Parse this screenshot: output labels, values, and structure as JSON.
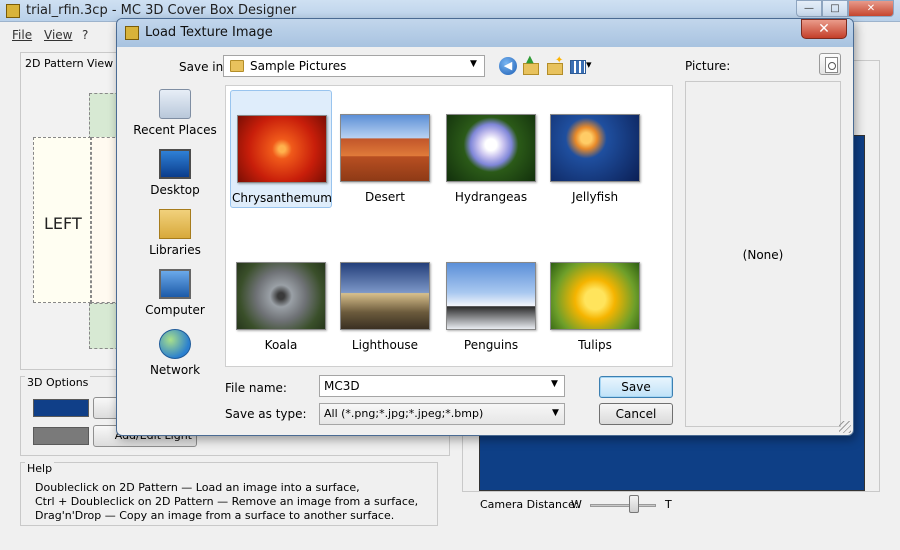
{
  "main_window": {
    "title": "trial_rfin.3cp - MC 3D Cover Box Designer",
    "menu": {
      "file": "File",
      "view": "View",
      "help": "?"
    },
    "pattern_panel": {
      "title": "2D Pattern View",
      "left_label": "LEFT"
    },
    "options_panel": {
      "title": "3D Options",
      "button_partial": "Add/Edit Light"
    },
    "help_panel": {
      "title": "Help",
      "lines": [
        "Doubleclick on 2D Pattern — Load an image into a surface,",
        "Ctrl + Doubleclick on 2D Pattern — Remove an image from a surface,",
        "Drag'n'Drop — Copy an image from a surface to another surface."
      ]
    },
    "camera": {
      "label": "Camera Distance:",
      "min_label": "W",
      "max_label": "T",
      "value": 0.7
    },
    "colors": {
      "swatch_primary": "#103f88",
      "swatch_secondary": "#7a7a7a",
      "preview_background": "#0e3f86"
    }
  },
  "dialog": {
    "title": "Load Texture Image",
    "close_glyph": "✕",
    "save_in_label": "Save in:",
    "save_in_value": "Sample Pictures",
    "places": [
      "Recent Places",
      "Desktop",
      "Libraries",
      "Computer",
      "Network"
    ],
    "files": [
      {
        "name": "Chrysanthemum",
        "selected": true
      },
      {
        "name": "Desert"
      },
      {
        "name": "Hydrangeas"
      },
      {
        "name": "Jellyfish"
      },
      {
        "name": "Koala"
      },
      {
        "name": "Lighthouse"
      },
      {
        "name": "Penguins"
      },
      {
        "name": "Tulips"
      }
    ],
    "picture_label": "Picture:",
    "picture_none": "(None)",
    "file_name_label": "File name:",
    "file_name_value": "MC3D",
    "save_as_type_label": "Save as type:",
    "save_as_type_value": "All (*.png;*.jpg;*.jpeg;*.bmp)",
    "save_button": "Save",
    "cancel_button": "Cancel"
  }
}
